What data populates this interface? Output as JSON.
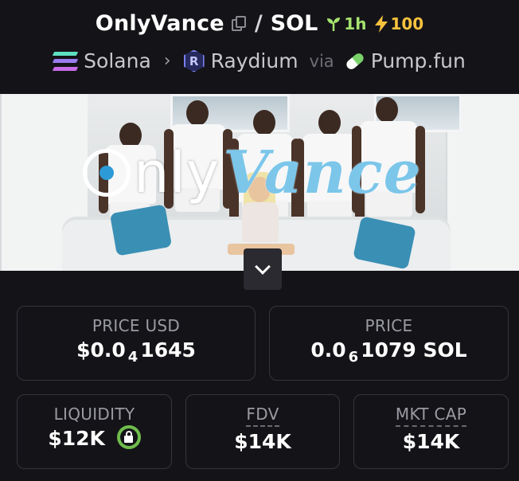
{
  "header": {
    "token_name": "OnlyVance",
    "quote_token": "SOL",
    "separator": "/",
    "age": "1h",
    "boosts": "100",
    "chain": "Solana",
    "dex": "Raydium",
    "via_label": "via",
    "launchpad": "Pump.fun",
    "age_color": "#a6e36f",
    "boost_color": "#f6c23e"
  },
  "banner": {
    "logo_text_only": "nly",
    "logo_text_vance": "Vance"
  },
  "stats": {
    "price_usd": {
      "label": "PRICE USD",
      "prefix": "$0.0",
      "zeros": "4",
      "digits": "1645"
    },
    "price_native": {
      "label": "PRICE",
      "prefix": "0.0",
      "zeros": "6",
      "digits": "1079 SOL"
    },
    "liquidity": {
      "label": "LIQUIDITY",
      "value": "$12K"
    },
    "fdv": {
      "label": "FDV",
      "value": "$14K"
    },
    "mkt_cap": {
      "label": "MKT CAP",
      "value": "$14K"
    }
  },
  "icons": {
    "copy": "copy-icon",
    "age": "seedling-icon",
    "boost": "lightning-icon",
    "chain": "solana-icon",
    "dex": "raydium-icon",
    "launchpad": "pill-icon",
    "expand": "chevron-down-icon",
    "lock": "lock-icon"
  },
  "colors": {
    "background": "#141418",
    "card_border": "#34343c",
    "label": "#9a9aa2",
    "lock": "#6fbd4c"
  }
}
